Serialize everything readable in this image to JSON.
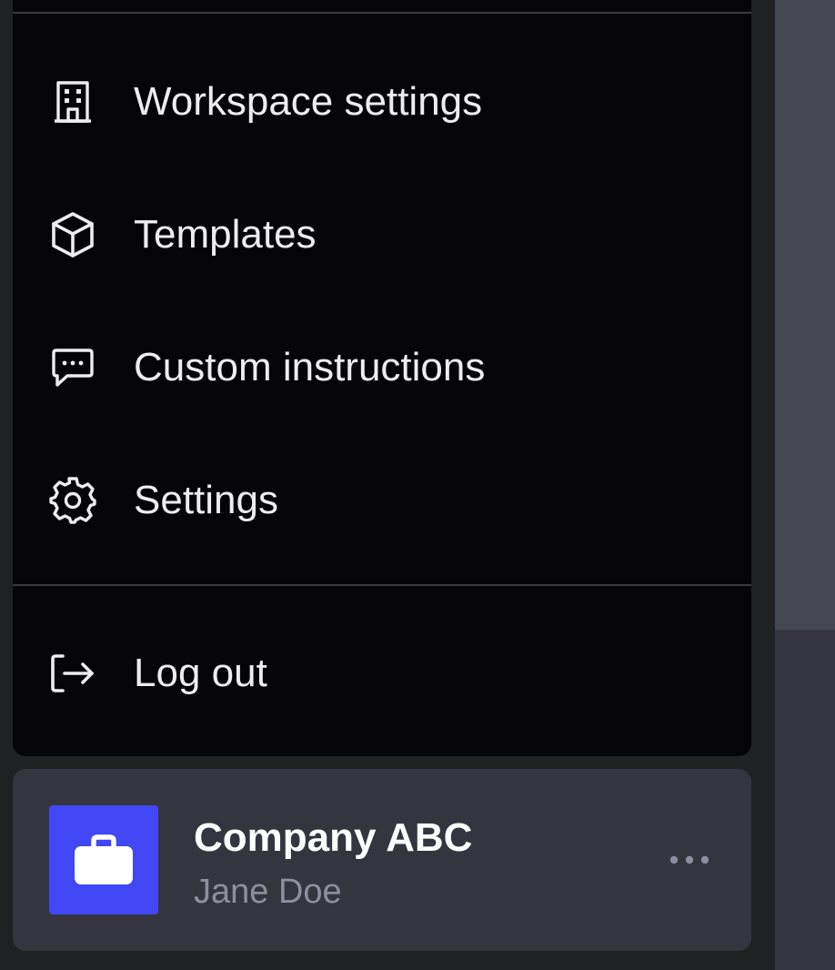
{
  "menu": {
    "items": [
      {
        "label": "Workspace settings",
        "icon": "building-icon"
      },
      {
        "label": "Templates",
        "icon": "cube-icon"
      },
      {
        "label": "Custom instructions",
        "icon": "chat-bubble-dots-icon"
      },
      {
        "label": "Settings",
        "icon": "gear-icon"
      }
    ],
    "logout": {
      "label": "Log out",
      "icon": "logout-icon"
    }
  },
  "account": {
    "company": "Company ABC",
    "user": "Jane Doe",
    "avatar_icon": "briefcase-icon",
    "more_icon": "ellipsis-icon"
  },
  "colors": {
    "menu_bg": "#050509",
    "sidebar_bg": "#202123",
    "account_bg": "#353540",
    "avatar_bg": "#4147f5",
    "text_primary": "#ececf1",
    "text_secondary": "#8e8ea0"
  }
}
